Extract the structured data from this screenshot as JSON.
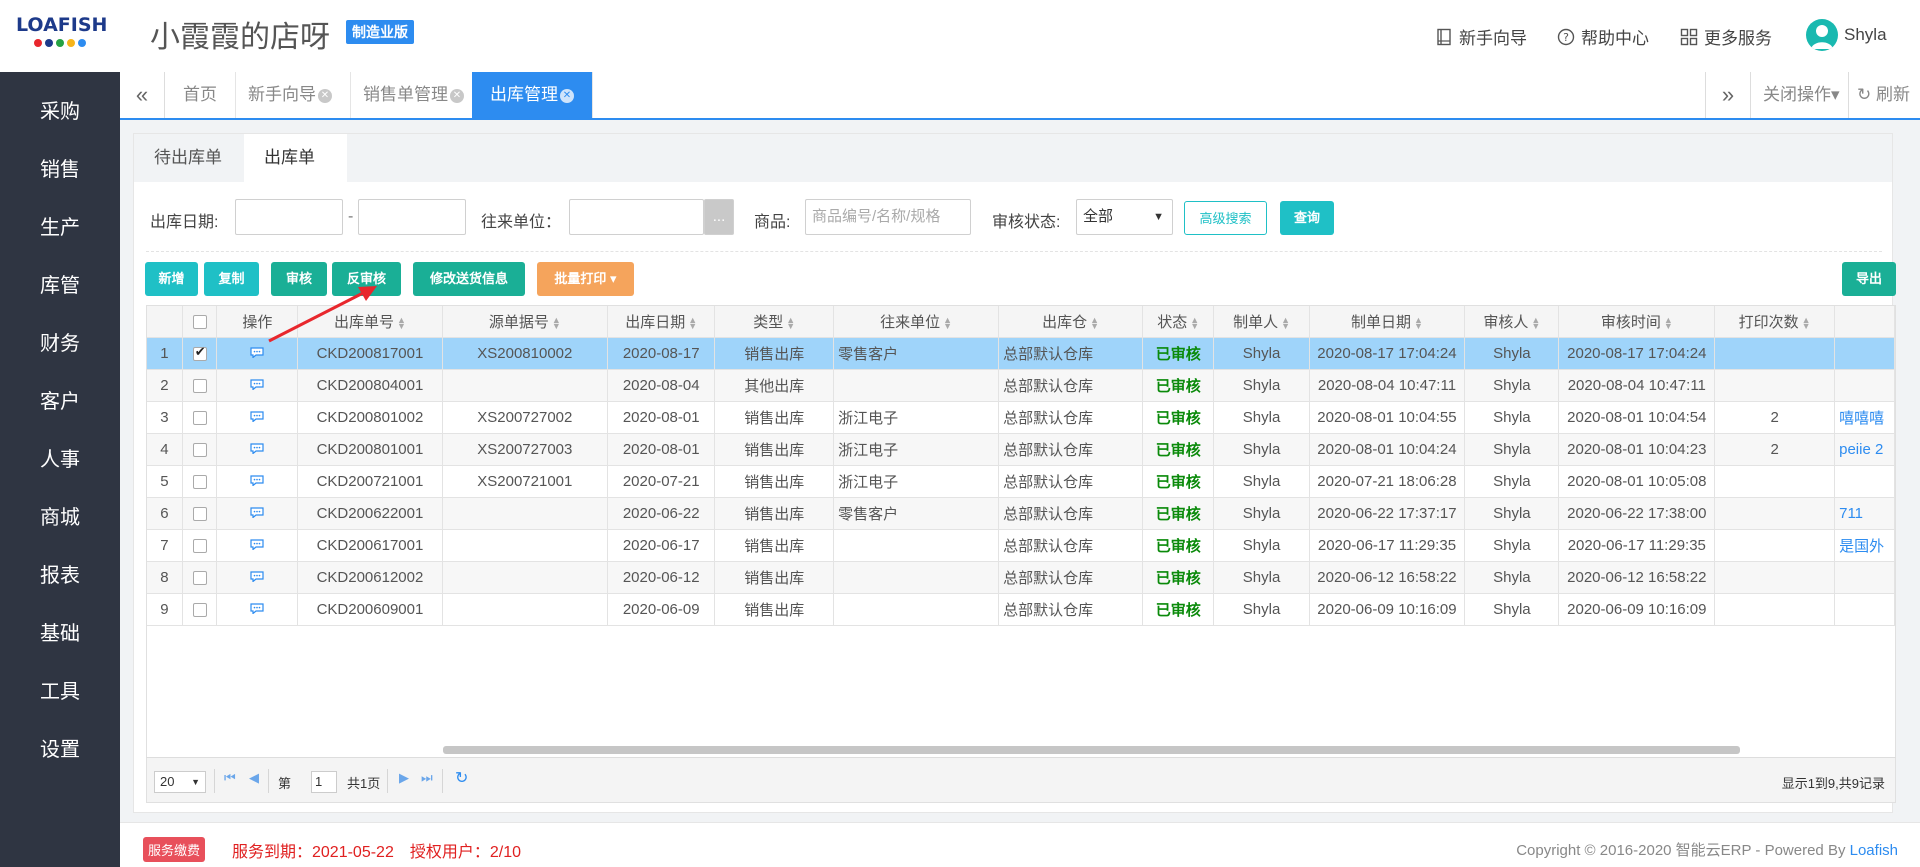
{
  "header": {
    "logo_text": "LOAFISH",
    "logo_dot_colors": [
      "#e8272d",
      "#1d3a8a",
      "#26a244",
      "#f6b41a",
      "#2d8cf0"
    ],
    "shop_name": "小霞霞的店呀",
    "edition": "制造业版",
    "links": {
      "guide": "新手向导",
      "help": "帮助中心",
      "more": "更多服务"
    },
    "user_name": "Shyla"
  },
  "sidebar": {
    "items": [
      "采购",
      "销售",
      "生产",
      "库管",
      "财务",
      "客户",
      "人事",
      "商城",
      "报表",
      "基础",
      "工具",
      "设置"
    ]
  },
  "tabbar": {
    "tabs": [
      {
        "label": "首页",
        "closable": false
      },
      {
        "label": "新手向导",
        "closable": true
      },
      {
        "label": "销售单管理",
        "closable": true
      },
      {
        "label": "出库管理",
        "closable": true,
        "active": true
      }
    ],
    "close_ops": "关闭操作▾",
    "refresh": "刷新"
  },
  "subtabs": [
    "待出库单",
    "出库单"
  ],
  "filters": {
    "date_label": "出库日期:",
    "date_sep": "-",
    "partner_label": "往来单位：",
    "partner_btn": "...",
    "goods_label": "商品:",
    "goods_placeholder": "商品编号/名称/规格",
    "audit_label": "审核状态:",
    "audit_value": "全部",
    "advanced_search": "高级搜索",
    "query": "查询"
  },
  "toolbar": {
    "add": "新增",
    "copy": "复制",
    "audit": "审核",
    "unaudit": "反审核",
    "edit_delivery": "修改送货信息",
    "batch_print": "批量打印 ▾",
    "export": "导出"
  },
  "grid": {
    "columns": [
      "操作",
      "出库单号",
      "源单据号",
      "出库日期",
      "类型",
      "往来单位",
      "出库仓",
      "状态",
      "制单人",
      "制单日期",
      "审核人",
      "审核时间",
      "打印次数"
    ],
    "rows": [
      {
        "no": "1",
        "selected": true,
        "code": "CKD200817001",
        "src": "XS200810002",
        "date": "2020-08-17",
        "type": "销售出库",
        "partner": "零售客户",
        "wh": "总部默认仓库",
        "status": "已审核",
        "maker": "Shyla",
        "make_time": "2020-08-17 17:04:24",
        "auditor": "Shyla",
        "audit_time": "2020-08-17 17:04:24",
        "prints": "",
        "remark": ""
      },
      {
        "no": "2",
        "selected": false,
        "code": "CKD200804001",
        "src": "",
        "date": "2020-08-04",
        "type": "其他出库",
        "partner": "",
        "wh": "总部默认仓库",
        "status": "已审核",
        "maker": "Shyla",
        "make_time": "2020-08-04 10:47:11",
        "auditor": "Shyla",
        "audit_time": "2020-08-04 10:47:11",
        "prints": "",
        "remark": ""
      },
      {
        "no": "3",
        "selected": false,
        "code": "CKD200801002",
        "src": "XS200727002",
        "date": "2020-08-01",
        "type": "销售出库",
        "partner": "浙江电子",
        "wh": "总部默认仓库",
        "status": "已审核",
        "maker": "Shyla",
        "make_time": "2020-08-01 10:04:55",
        "auditor": "Shyla",
        "audit_time": "2020-08-01 10:04:54",
        "prints": "2",
        "remark": "嘻嘻嘻"
      },
      {
        "no": "4",
        "selected": false,
        "code": "CKD200801001",
        "src": "XS200727003",
        "date": "2020-08-01",
        "type": "销售出库",
        "partner": "浙江电子",
        "wh": "总部默认仓库",
        "status": "已审核",
        "maker": "Shyla",
        "make_time": "2020-08-01 10:04:24",
        "auditor": "Shyla",
        "audit_time": "2020-08-01 10:04:23",
        "prints": "2",
        "remark": "peiie 2"
      },
      {
        "no": "5",
        "selected": false,
        "code": "CKD200721001",
        "src": "XS200721001",
        "date": "2020-07-21",
        "type": "销售出库",
        "partner": "浙江电子",
        "wh": "总部默认仓库",
        "status": "已审核",
        "maker": "Shyla",
        "make_time": "2020-07-21 18:06:28",
        "auditor": "Shyla",
        "audit_time": "2020-08-01 10:05:08",
        "prints": "",
        "remark": ""
      },
      {
        "no": "6",
        "selected": false,
        "code": "CKD200622001",
        "src": "",
        "date": "2020-06-22",
        "type": "销售出库",
        "partner": "零售客户",
        "wh": "总部默认仓库",
        "status": "已审核",
        "maker": "Shyla",
        "make_time": "2020-06-22 17:37:17",
        "auditor": "Shyla",
        "audit_time": "2020-06-22 17:38:00",
        "prints": "",
        "remark": "711"
      },
      {
        "no": "7",
        "selected": false,
        "code": "CKD200617001",
        "src": "",
        "date": "2020-06-17",
        "type": "销售出库",
        "partner": "",
        "wh": "总部默认仓库",
        "status": "已审核",
        "maker": "Shyla",
        "make_time": "2020-06-17 11:29:35",
        "auditor": "Shyla",
        "audit_time": "2020-06-17 11:29:35",
        "prints": "",
        "remark": "是国外"
      },
      {
        "no": "8",
        "selected": false,
        "code": "CKD200612002",
        "src": "",
        "date": "2020-06-12",
        "type": "销售出库",
        "partner": "",
        "wh": "总部默认仓库",
        "status": "已审核",
        "maker": "Shyla",
        "make_time": "2020-06-12 16:58:22",
        "auditor": "Shyla",
        "audit_time": "2020-06-12 16:58:22",
        "prints": "",
        "remark": ""
      },
      {
        "no": "9",
        "selected": false,
        "code": "CKD200609001",
        "src": "",
        "date": "2020-06-09",
        "type": "销售出库",
        "partner": "",
        "wh": "总部默认仓库",
        "status": "已审核",
        "maker": "Shyla",
        "make_time": "2020-06-09 10:16:09",
        "auditor": "Shyla",
        "audit_time": "2020-06-09 10:16:09",
        "prints": "",
        "remark": ""
      }
    ]
  },
  "pager": {
    "page_size": "20",
    "page_prefix": "第",
    "page_value": "1",
    "page_total": "共1页",
    "summary": "显示1到9,共9记录"
  },
  "footer": {
    "pay_badge": "服务缴费",
    "expire": "服务到期：2021-05-22　授权用户：2/10",
    "copyright": "Copyright © 2016-2020 智能云ERP - Powered By ",
    "powered_link": "Loafish"
  },
  "colors": {
    "primary": "#2d8cf0",
    "sidebar_bg": "#2f3542",
    "teal": "#1aaf96",
    "cyan": "#1fc0c6",
    "orange": "#f5a45c",
    "selected_row": "#9fd4fa",
    "status_ok": "#0a8a0a",
    "annotation_arrow": "#e8272d"
  }
}
